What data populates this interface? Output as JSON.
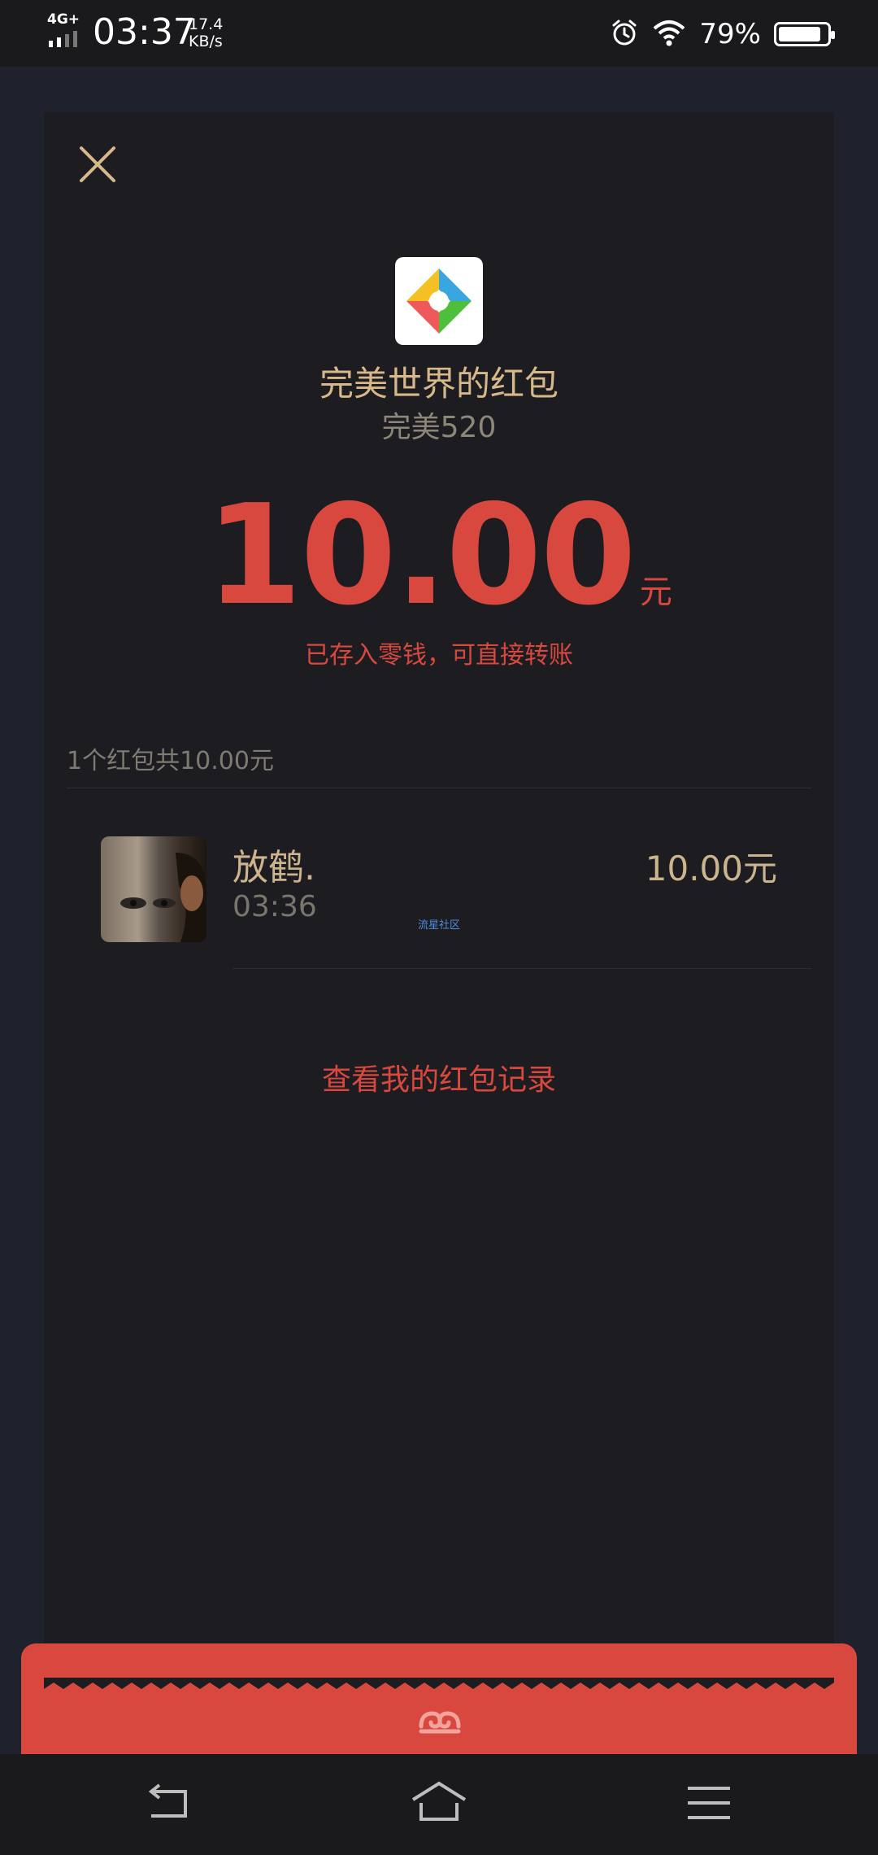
{
  "status_bar": {
    "network": "4G+",
    "time": "03:37",
    "speed_value": "17.4",
    "speed_unit": "KB/s",
    "battery_percent": "79%",
    "battery_level": 0.79,
    "icons": [
      "signal-icon",
      "alarm-icon",
      "wifi-icon",
      "battery-icon"
    ]
  },
  "header": {
    "close_icon": "close-icon"
  },
  "packet": {
    "app_logo": "perfect-world-logo",
    "sender_title": "完美世界的红包",
    "greeting": "完美520",
    "amount": "10.00",
    "unit": "元",
    "stored_note": "已存入零钱，可直接转账"
  },
  "summary": {
    "text": "1个红包共10.00元"
  },
  "records": [
    {
      "name": "放鹤.",
      "time": "03:36",
      "amount": "10.00元",
      "watermark": "流星社区"
    }
  ],
  "actions": {
    "view_records": "查看我的红包记录"
  },
  "bottom_strip": {
    "icon": "cloud-swirl-icon",
    "color": "#d9483f"
  },
  "nav_bar": {
    "buttons": [
      "back-icon",
      "home-icon",
      "menu-icon"
    ]
  },
  "colors": {
    "accent_red": "#d9483f",
    "gold": "#d6b88a",
    "card_bg": "#1c1c21",
    "page_bg": "#1f222c"
  }
}
